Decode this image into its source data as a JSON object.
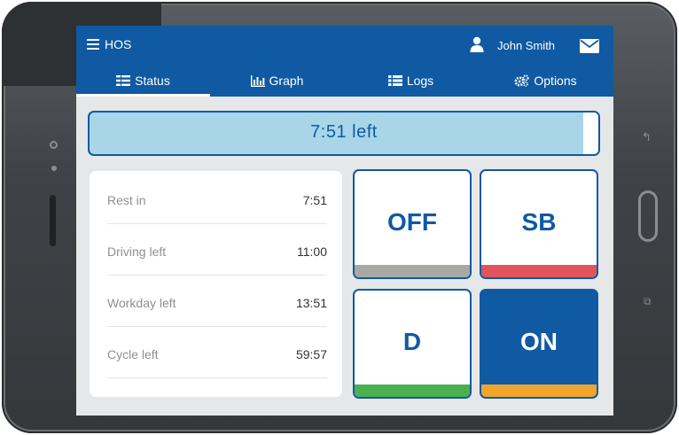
{
  "app": {
    "title": "HOS"
  },
  "user": {
    "name": "John Smith"
  },
  "tabs": [
    {
      "label": "Status",
      "icon": "status-list-icon",
      "active": true
    },
    {
      "label": "Graph",
      "icon": "bar-graph-icon",
      "active": false
    },
    {
      "label": "Logs",
      "icon": "list-icon",
      "active": false
    },
    {
      "label": "Options",
      "icon": "gears-icon",
      "active": false
    }
  ],
  "time_left": {
    "text": "7:51 left",
    "progress": 0.97
  },
  "info": [
    {
      "label": "Rest in",
      "value": "7:51"
    },
    {
      "label": "Driving left",
      "value": "11:00"
    },
    {
      "label": "Workday left",
      "value": "13:51"
    },
    {
      "label": "Cycle left",
      "value": "59:57"
    }
  ],
  "status_buttons": [
    {
      "label": "OFF",
      "color": "#a9a9a3",
      "selected": false
    },
    {
      "label": "SB",
      "color": "#e2545b",
      "selected": false
    },
    {
      "label": "D",
      "color": "#4bb04f",
      "selected": false
    },
    {
      "label": "ON",
      "color": "#f0a52c",
      "selected": true
    }
  ],
  "colors": {
    "primary": "#0f5aa2",
    "progress_bg": "#a9d5e8",
    "page_bg": "#e6e7e8"
  }
}
